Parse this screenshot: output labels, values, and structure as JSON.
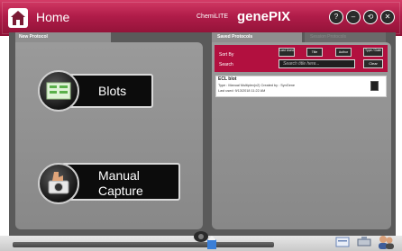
{
  "header": {
    "home_label": "Home",
    "brand_small": "ChemiLITE",
    "brand_name": "genePIX",
    "buttons": [
      "?",
      "–",
      "⟲",
      "✕"
    ]
  },
  "left_panel": {
    "tab_label": "New Protocol",
    "actions": [
      {
        "label": "Blots",
        "icon": "blots-icon"
      },
      {
        "label_line1": "Manual",
        "label_line2": "Capture",
        "icon": "camera-icon"
      }
    ]
  },
  "right_panel": {
    "tabs": {
      "saved": "Saved Protocols",
      "session": "Session Protocols"
    },
    "sort_label": "Sort By",
    "sort_buttons": [
      "Last Used",
      "Title",
      "Author",
      "Type / Date"
    ],
    "search_label": "Search",
    "search_placeholder": "Search title here...",
    "clear_label": "Clear",
    "protocols": [
      {
        "title": "ECL blot",
        "type_line": "Type : Manual Multiplex(x2)   Created by : SynGene",
        "last_used": "Last used:   9/13/2018 11:22 AM"
      }
    ]
  },
  "colors": {
    "accent": "#b2103f",
    "panel": "#8e8e8e",
    "workspace": "#5a5a5a"
  }
}
